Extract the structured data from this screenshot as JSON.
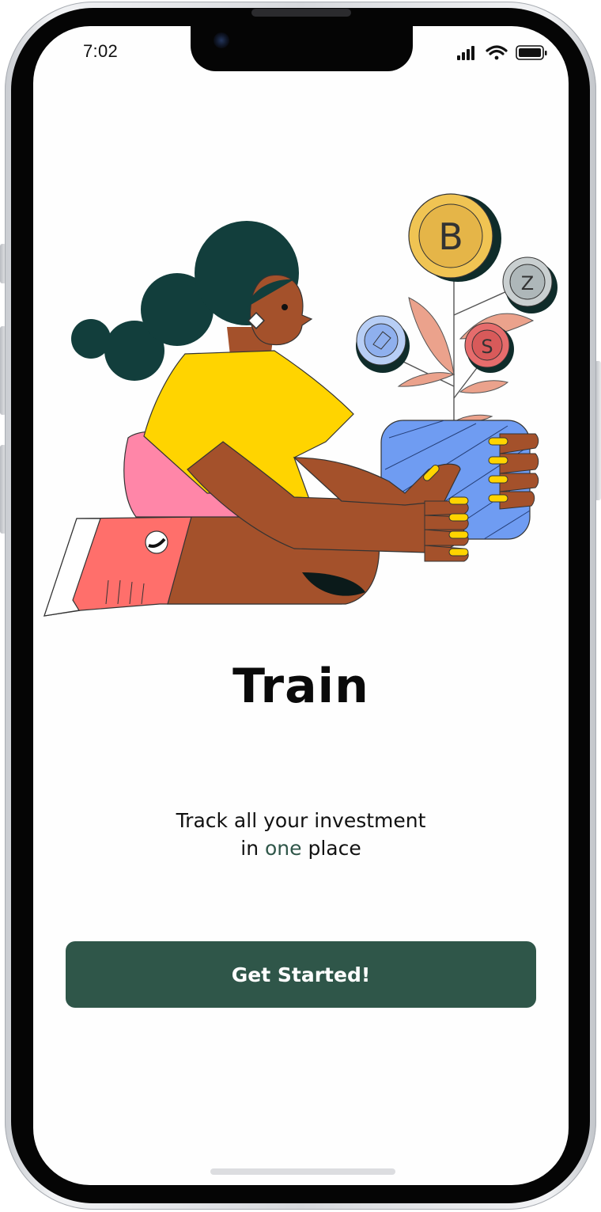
{
  "status_bar": {
    "time": "7:02",
    "signal_icon": "cellular-signal-icon",
    "wifi_icon": "wifi-icon",
    "battery_icon": "battery-icon"
  },
  "illustration": {
    "subject": "person-holding-crypto-plant-illustration",
    "coin_icons": [
      "bitcoin-coin-icon",
      "tether-coin-icon",
      "ethereum-coin-icon",
      "dollar-coin-icon"
    ]
  },
  "onboarding": {
    "title": "Train",
    "subtitle_line1": "Track all your investment",
    "subtitle_prefix": "in ",
    "subtitle_highlight": "one",
    "subtitle_suffix": " place",
    "cta_label": "Get Started!"
  },
  "colors": {
    "primary": "#2f5649",
    "highlight_text": "#2f5649",
    "background": "#fefefe"
  }
}
